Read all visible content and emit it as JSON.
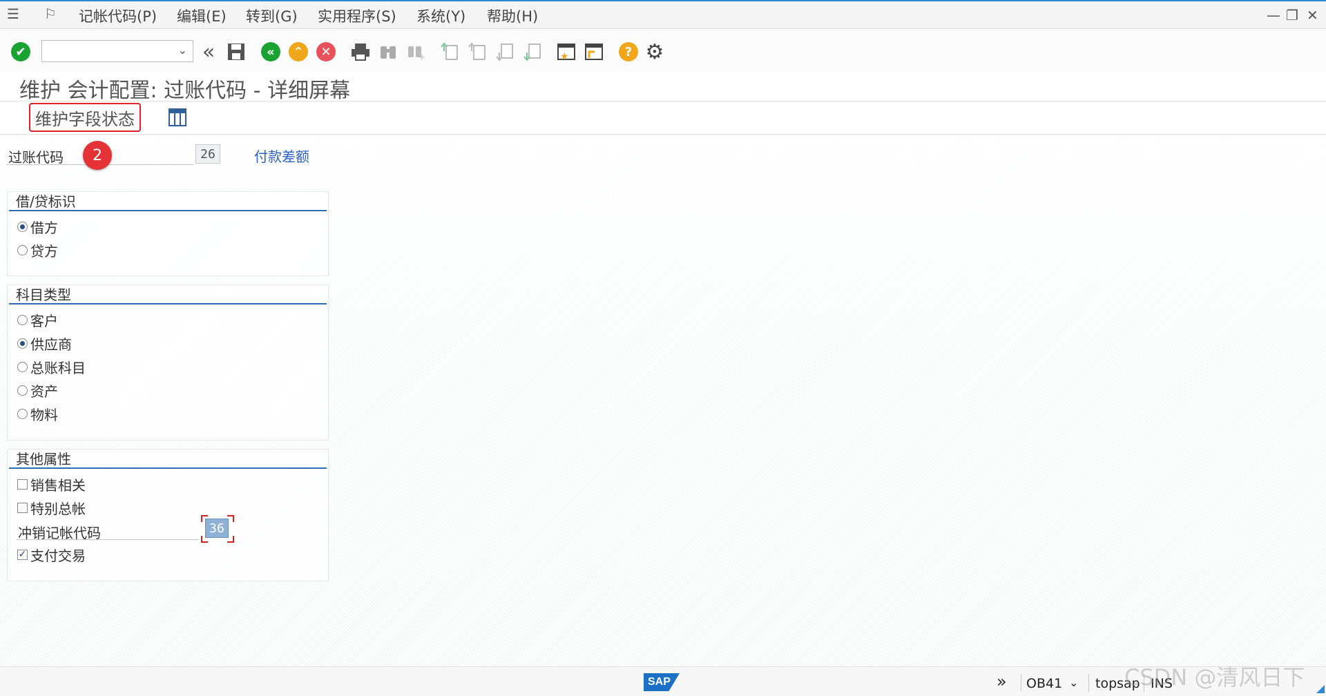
{
  "menu": {
    "items": [
      "记帐代码(P)",
      "编辑(E)",
      "转到(G)",
      "实用程序(S)",
      "系统(Y)",
      "帮助(H)"
    ]
  },
  "window_controls": {
    "minimize": "—",
    "restore": "❐",
    "close": "✕"
  },
  "toolbar": {
    "icons": [
      "enter-icon",
      "back-double-icon",
      "save-icon",
      "back-icon",
      "exit-icon",
      "cancel-icon",
      "print-icon",
      "find-icon",
      "find-next-icon",
      "first-page-icon",
      "previous-page-icon",
      "next-page-icon",
      "last-page-icon",
      "create-session-icon",
      "generate-shortcut-icon",
      "help-icon",
      "customize-layout-icon"
    ],
    "command_field_value": ""
  },
  "page_title": "维护 会计配置: 过账代码 - 详细屏幕",
  "app_toolbar": {
    "maintain_field_status_label": "维护字段状态"
  },
  "posting_key": {
    "label": "过账代码",
    "value": "26",
    "description": "付款差额",
    "step_badge": "2"
  },
  "debit_credit": {
    "title": "借/贷标识",
    "options": [
      {
        "label": "借方",
        "selected": true
      },
      {
        "label": "贷方",
        "selected": false
      }
    ]
  },
  "account_type": {
    "title": "科目类型",
    "options": [
      {
        "label": "客户",
        "selected": false
      },
      {
        "label": "供应商",
        "selected": true
      },
      {
        "label": "总账科目",
        "selected": false
      },
      {
        "label": "资产",
        "selected": false
      },
      {
        "label": "物料",
        "selected": false
      }
    ]
  },
  "other_attributes": {
    "title": "其他属性",
    "sales_related": {
      "label": "销售相关",
      "checked": false
    },
    "special_gl": {
      "label": "特别总帐",
      "checked": false
    },
    "reversal_posting_key": {
      "label": "冲销记帐代码",
      "value": "36"
    },
    "payment_transaction": {
      "label": "支付交易",
      "checked": true
    }
  },
  "status_bar": {
    "logo": "SAP",
    "expand": "»",
    "transaction": "OB41",
    "system": "topsap",
    "mode": "INS"
  },
  "watermark": "CSDN @清风日下",
  "colors": {
    "accent_blue": "#2a6fb5",
    "link_blue": "#2a5fc9",
    "highlight_red": "#e0202a",
    "badge_red": "#e53236",
    "enter_green": "#1aa332",
    "exit_orange": "#f0a81a",
    "cancel_red": "#e8505b"
  }
}
